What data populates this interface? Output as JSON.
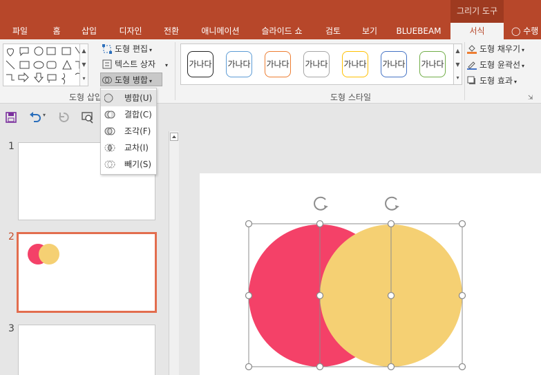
{
  "ribbon": {
    "context_group": "그리기 도구",
    "tabs": [
      {
        "label": "파일"
      },
      {
        "label": "홈"
      },
      {
        "label": "삽입"
      },
      {
        "label": "디자인"
      },
      {
        "label": "전환"
      },
      {
        "label": "애니메이션"
      },
      {
        "label": "슬라이드 쇼"
      },
      {
        "label": "검토"
      },
      {
        "label": "보기"
      },
      {
        "label": "BLUEBEAM"
      },
      {
        "label": "서식"
      },
      {
        "label": "수행"
      }
    ],
    "insert_shapes": {
      "group_label": "도형 삽입",
      "edit_shape": "도형 편집",
      "text_box": "텍스트 상자",
      "merge_shapes": "도형 병합"
    },
    "shape_styles": {
      "group_label": "도형 스타일",
      "swatch_text": "가나다",
      "swatch_colors": [
        "#222222",
        "#5b9bd5",
        "#ed7d31",
        "#a5a5a5",
        "#ffc000",
        "#4472c4",
        "#70ad47"
      ],
      "fill": "도형 채우기",
      "outline": "도형 윤곽선",
      "effects": "도형 효과"
    }
  },
  "merge_menu": {
    "items": [
      {
        "label": "병합(U)"
      },
      {
        "label": "결합(C)"
      },
      {
        "label": "조각(F)"
      },
      {
        "label": "교차(I)"
      },
      {
        "label": "빼기(S)"
      }
    ]
  },
  "slides": [
    {
      "number": "1"
    },
    {
      "number": "2"
    },
    {
      "number": "3"
    }
  ],
  "colors": {
    "accent": "#b7472a",
    "circle_left": "#f44168",
    "circle_right": "#f5d073",
    "selection": "#e26d4e"
  }
}
